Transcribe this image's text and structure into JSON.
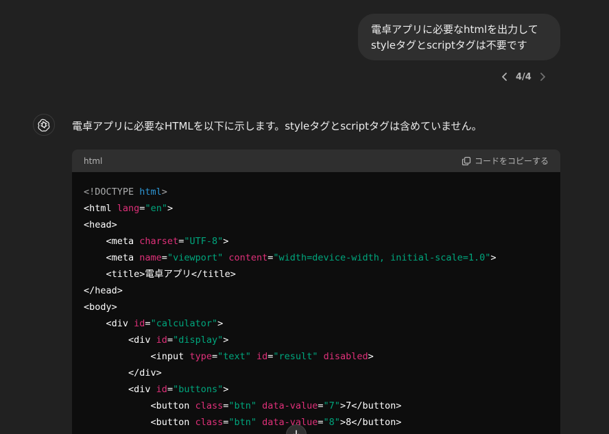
{
  "user_message": {
    "line1": "電卓アプリに必要なhtmlを出力して",
    "line2": "styleタグとscriptタグは不要です"
  },
  "pager": {
    "count": "4/4"
  },
  "assistant": {
    "intro": "電卓アプリに必要なHTMLを以下に示します。styleタグとscriptタグは含めていません。"
  },
  "code_block": {
    "language": "html",
    "copy_label": "コードをコピーする",
    "lines": [
      "<!DOCTYPE html>",
      "<html lang=\"en\">",
      "<head>",
      "    <meta charset=\"UTF-8\">",
      "    <meta name=\"viewport\" content=\"width=device-width, initial-scale=1.0\">",
      "    <title>電卓アプリ</title>",
      "</head>",
      "<body>",
      "    <div id=\"calculator\">",
      "        <div id=\"display\">",
      "            <input type=\"text\" id=\"result\" disabled>",
      "        </div>",
      "        <div id=\"buttons\">",
      "            <button class=\"btn\" data-value=\"7\">7</button>",
      "            <button class=\"btn\" data-value=\"8\">8</button>"
    ]
  },
  "icons": {
    "avatar": "openai-logo-icon",
    "copy": "copy-icon",
    "prev": "chevron-left-icon",
    "next": "chevron-right-icon",
    "scroll": "arrow-down-icon"
  }
}
